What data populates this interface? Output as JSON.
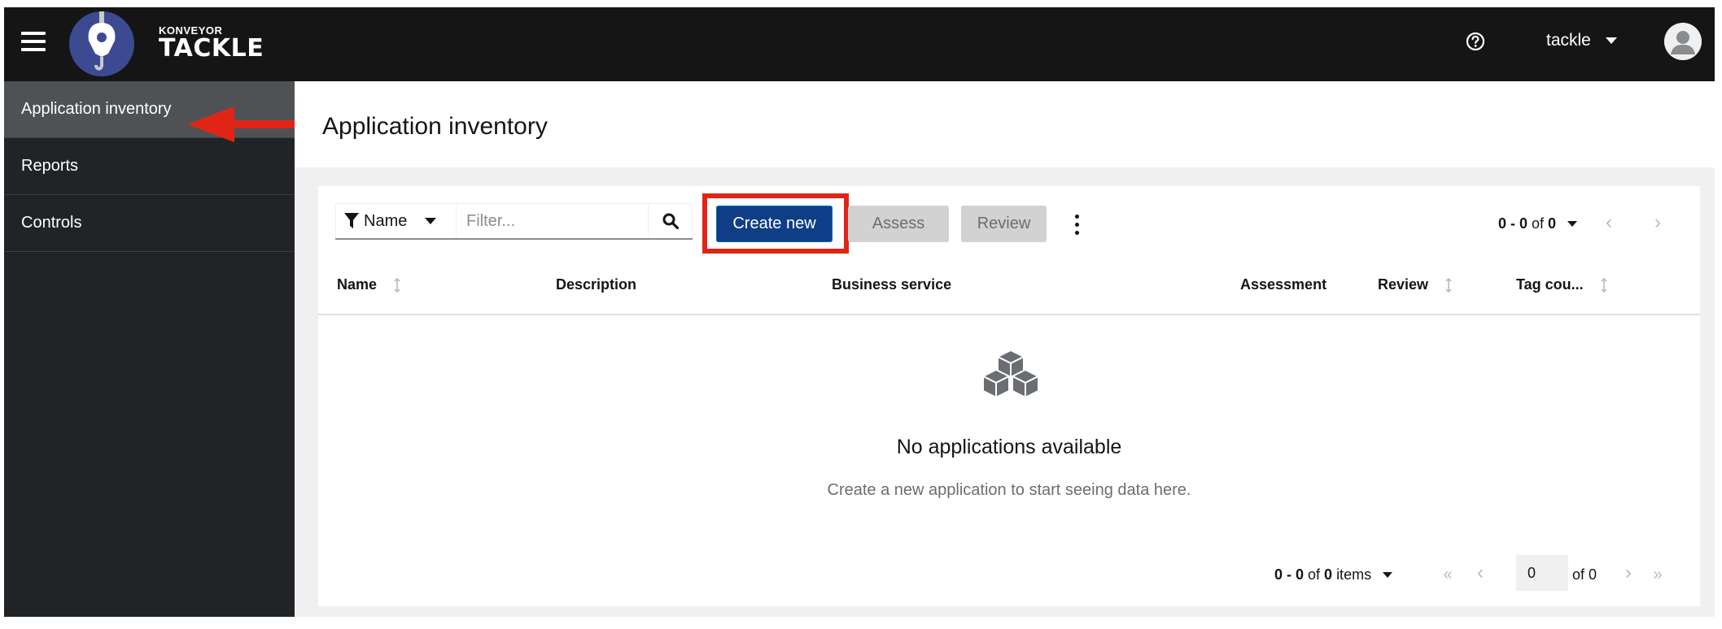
{
  "masthead": {
    "brand_top": "KONVEYOR",
    "brand_main": "TACKLE",
    "username": "tackle"
  },
  "sidebar": {
    "items": [
      {
        "label": "Application inventory",
        "active": true
      },
      {
        "label": "Reports",
        "active": false
      },
      {
        "label": "Controls",
        "active": false
      }
    ]
  },
  "page": {
    "title": "Application inventory"
  },
  "toolbar": {
    "filter_label": "Name",
    "filter_placeholder": "Filter...",
    "create_label": "Create new",
    "assess_label": "Assess",
    "review_label": "Review"
  },
  "pagination_top": {
    "range": "0 - 0",
    "of_word": "of",
    "total": "0"
  },
  "table": {
    "columns": [
      "Name",
      "Description",
      "Business service",
      "Assessment",
      "Review",
      "Tag cou..."
    ]
  },
  "empty_state": {
    "title": "No applications available",
    "body": "Create a new application to start seeing data here."
  },
  "pagination_bottom": {
    "range": "0 - 0",
    "of_word": "of",
    "total": "0",
    "items_word": "items",
    "page_value": "0",
    "of_pages": "of 0"
  },
  "annotation": {
    "color": "#e02517"
  },
  "colors": {
    "masthead": "#151515",
    "sidebar": "#212427",
    "sidebar_active": "#4f5255",
    "primary_button": "#0f3e86",
    "disabled_button": "#d2d2d2"
  }
}
